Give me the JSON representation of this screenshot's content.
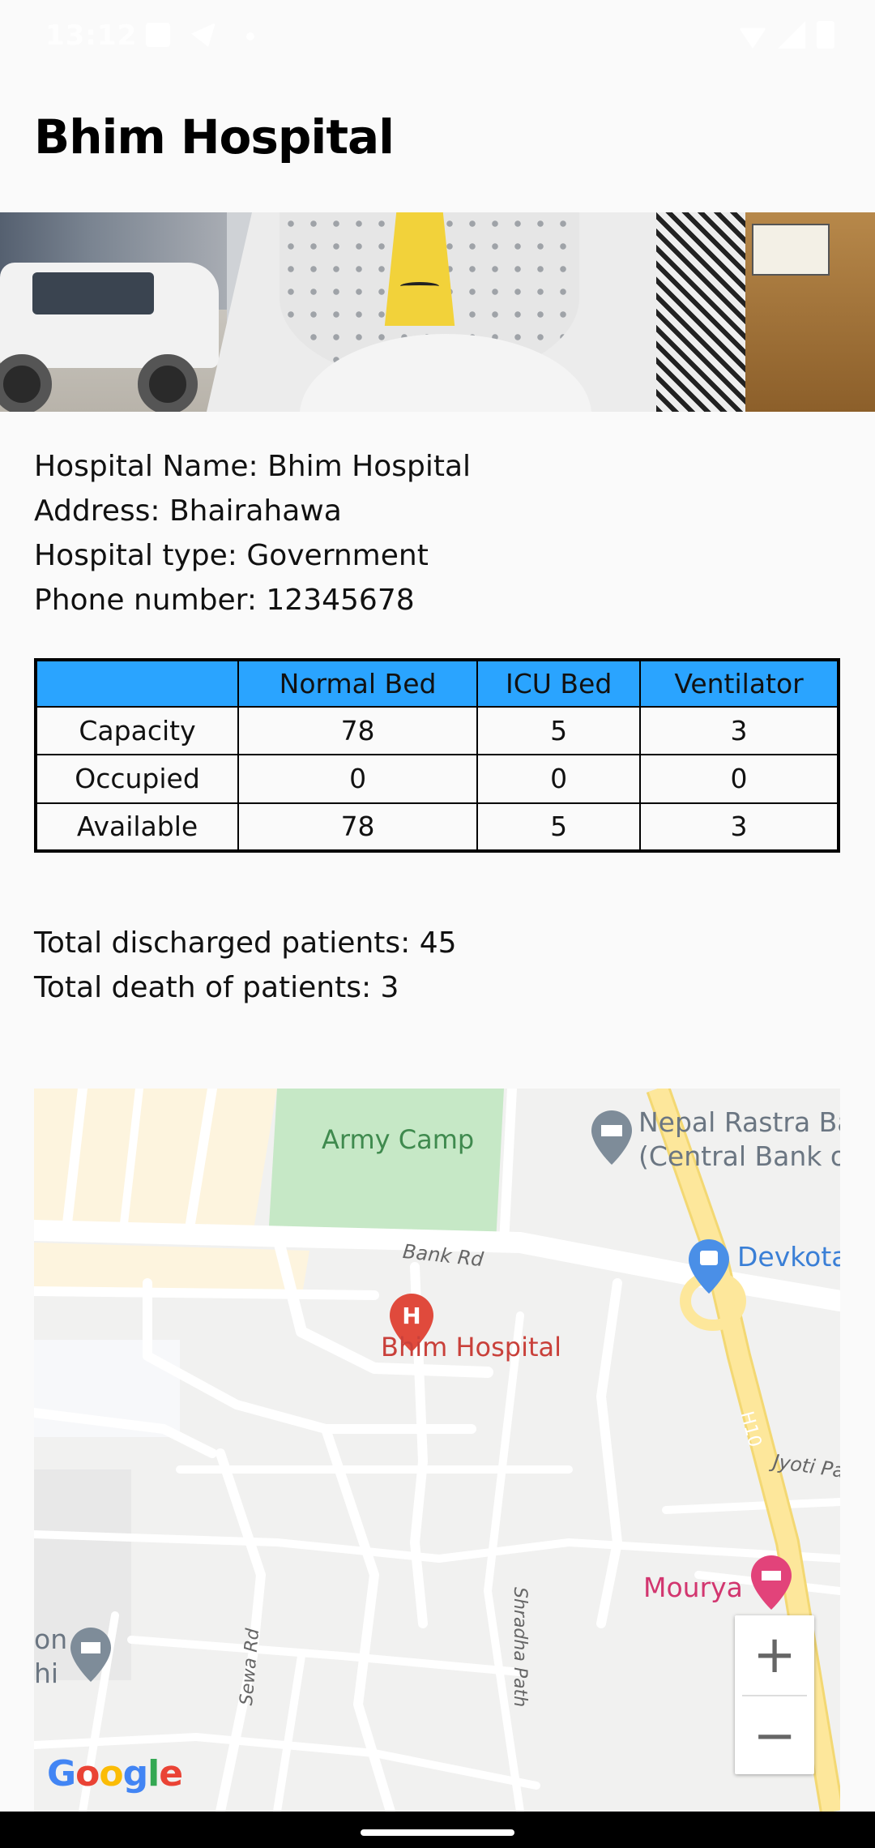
{
  "status_bar": {
    "time": "13:12",
    "left_icons": [
      "image-icon",
      "telegram-icon",
      "dot-icon"
    ],
    "right_icons": [
      "wifi-icon",
      "signal-icon",
      "battery-icon"
    ]
  },
  "header": {
    "title": "Bhim Hospital"
  },
  "hospital": {
    "name_line": "Hospital Name: Bhim Hospital",
    "address_line": "Address: Bhairahawa",
    "type_line": "Hospital type: Government",
    "phone_line": "Phone number: 12345678"
  },
  "bed_table": {
    "header_color": "#2aa4ff",
    "columns": [
      "",
      "Normal Bed",
      "ICU Bed",
      "Ventilator"
    ],
    "rows": [
      {
        "label": "Capacity",
        "values": [
          "78",
          "5",
          "3"
        ]
      },
      {
        "label": "Occupied",
        "values": [
          "0",
          "0",
          "0"
        ]
      },
      {
        "label": "Available",
        "values": [
          "78",
          "5",
          "3"
        ]
      }
    ]
  },
  "stats": {
    "discharged": "Total discharged patients: 45",
    "deaths": "Total death of patients: 3"
  },
  "map": {
    "labels": {
      "army_camp": "Army Camp",
      "bank_rd": "Bank Rd",
      "hospital": "Bhim Hospital",
      "nepal_rastra_1": "Nepal Rastra Ba",
      "nepal_rastra_2": "(Central Bank of",
      "devkota": "Devkota",
      "h10": "H10",
      "jyoti": "Jyoti Pa",
      "shradha": "Shradha Path",
      "sewa": "Sewa Rd",
      "mourya": "Mourya",
      "on": "on",
      "hi": "hi"
    },
    "zoom_in": "+",
    "zoom_out": "−",
    "attribution": [
      "G",
      "o",
      "o",
      "g",
      "l",
      "e"
    ],
    "colors": {
      "park": "#c6e8c6",
      "highway": "#fbe08e",
      "hospital_pin": "#e04a3c",
      "poi_blue": "#4a8fe7",
      "poi_pink": "#e2437a",
      "poi_gray": "#7e8c99"
    }
  }
}
